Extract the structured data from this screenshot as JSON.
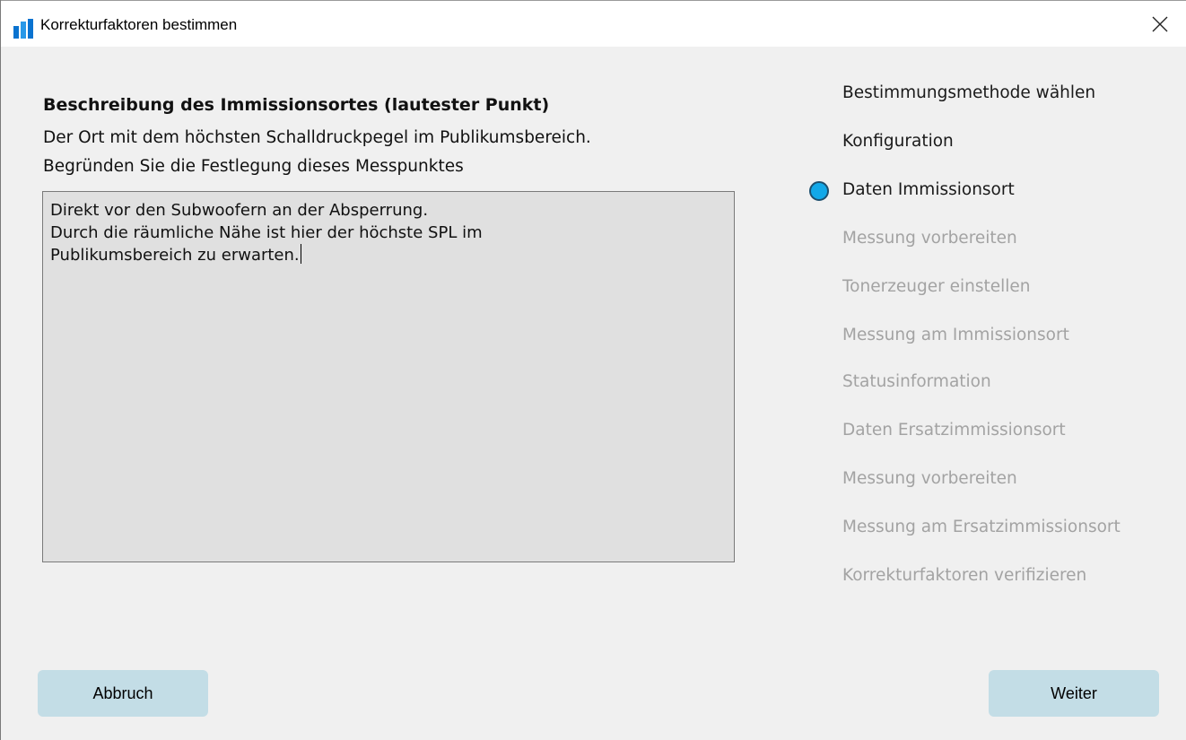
{
  "window": {
    "title": "Korrekturfaktoren bestimmen",
    "app_icon": "bar-chart-icon",
    "close_icon": "close-icon"
  },
  "main": {
    "heading": "Beschreibung des Immissionsortes (lautester Punkt)",
    "description_line1": "Der Ort mit dem höchsten Schalldruckpegel im Publikumsbereich.",
    "description_line2": "Begründen Sie die Festlegung dieses Messpunktes",
    "textarea_value": "Direkt vor den Subwoofern an der Absperrung.\nDurch die räumliche Nähe ist hier der höchste SPL im\nPublikumsbereich zu erwarten."
  },
  "steps": [
    {
      "label": "Bestimmungsmethode wählen",
      "state": "done"
    },
    {
      "label": "Konfiguration",
      "state": "done"
    },
    {
      "label": "Daten Immissionsort",
      "state": "active"
    },
    {
      "label": "Messung vorbereiten",
      "state": "pending"
    },
    {
      "label": "Tonerzeuger einstellen",
      "state": "pending"
    },
    {
      "label": "Messung am Immissionsort",
      "state": "pending"
    },
    {
      "label": "Statusinformation",
      "state": "pending"
    },
    {
      "label": "Daten Ersatzimmissionsort",
      "state": "pending"
    },
    {
      "label": "Messung vorbereiten",
      "state": "pending"
    },
    {
      "label": "Messung am Ersatzimmissionsort",
      "state": "pending"
    },
    {
      "label": "Korrekturfaktoren verifizieren",
      "state": "pending"
    }
  ],
  "buttons": {
    "cancel_label": "Abbruch",
    "next_label": "Weiter"
  },
  "colors": {
    "accent": "#12a8e8",
    "button_bg": "#c3dde6",
    "pending_text": "#a3a3a3"
  }
}
